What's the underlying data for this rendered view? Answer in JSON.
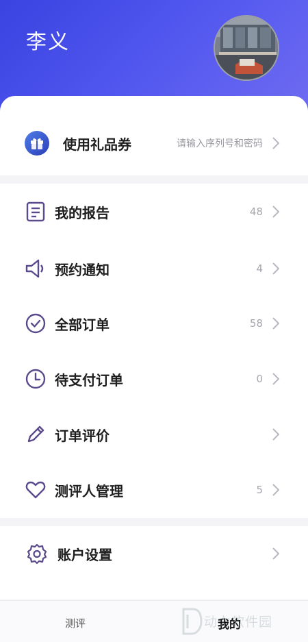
{
  "header": {
    "user_name": "李义"
  },
  "gift": {
    "label": "使用礼品券",
    "hint": "请输入序列号和密码",
    "icon": "gift-icon"
  },
  "menu": [
    {
      "label": "我的报告",
      "count": "48",
      "icon": "report-icon"
    },
    {
      "label": "预约通知",
      "count": "4",
      "icon": "speaker-icon"
    },
    {
      "label": "全部订单",
      "count": "58",
      "icon": "check-circle-icon"
    },
    {
      "label": "待支付订单",
      "count": "0",
      "icon": "clock-icon"
    },
    {
      "label": "订单评价",
      "count": "",
      "icon": "pencil-icon"
    },
    {
      "label": "测评人管理",
      "count": "5",
      "icon": "heart-icon"
    }
  ],
  "settings": {
    "label": "账户设置",
    "icon": "settings-gear-icon"
  },
  "tabbar": {
    "tab1": "测评",
    "tab2": "我的"
  },
  "watermark": {
    "text": "动力软件园"
  },
  "colors": {
    "accent": "#4f55ee",
    "icon_purple": "#5a4a8c"
  }
}
